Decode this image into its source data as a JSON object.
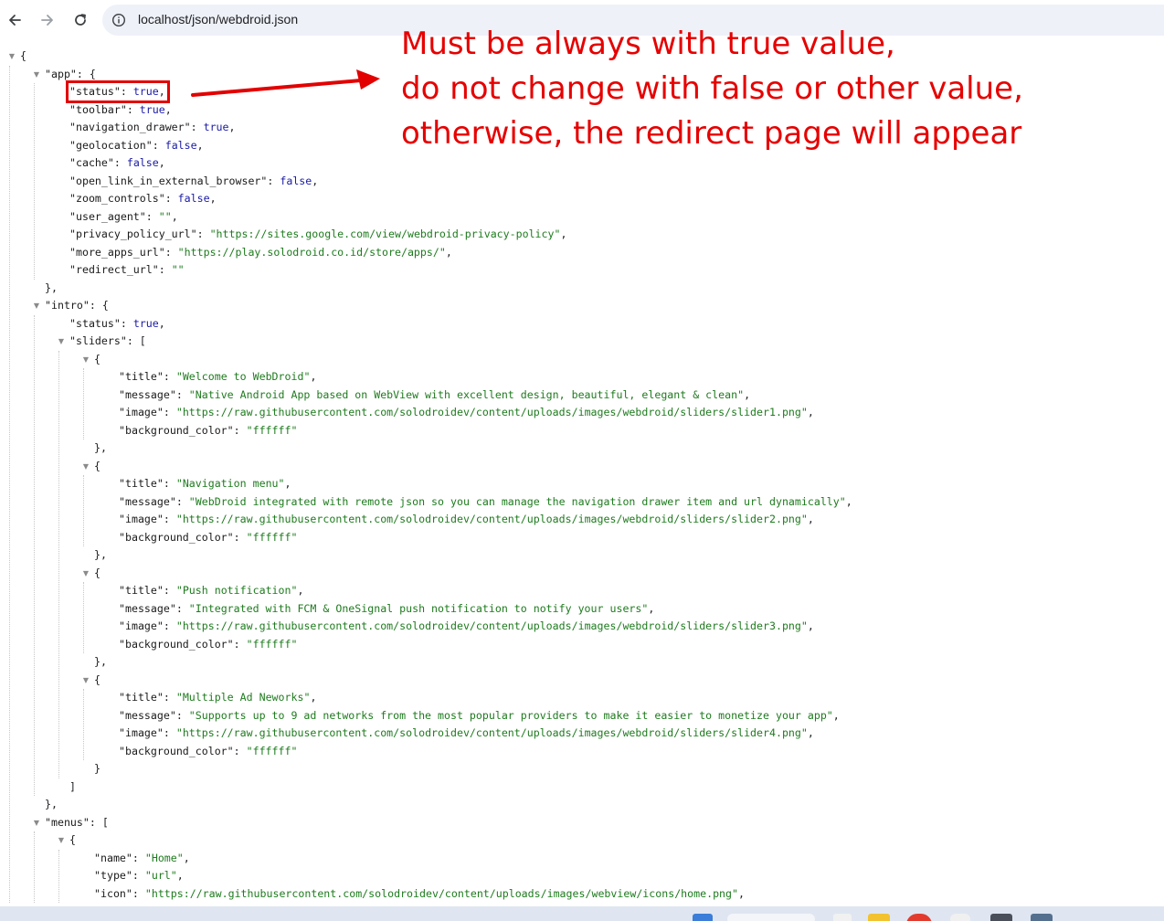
{
  "browser": {
    "url": "localhost/json/webdroid.json",
    "back_label": "Back",
    "forward_label": "Forward",
    "reload_label": "Reload"
  },
  "annotation": {
    "lines": [
      "Must be always with true value,",
      "do not change with false or other value,",
      "otherwise, the redirect page will appear"
    ],
    "color": "#e60000"
  },
  "json_lines": [
    {
      "i": 0,
      "fold": true,
      "t": [
        [
          "p",
          "{"
        ]
      ]
    },
    {
      "i": 1,
      "fold": true,
      "t": [
        [
          "k",
          "\"app\""
        ],
        [
          "p",
          ": {"
        ]
      ]
    },
    {
      "i": 2,
      "t": [
        [
          "k",
          "\"status\""
        ],
        [
          "p",
          ": "
        ],
        [
          "b",
          "true"
        ],
        [
          "p",
          ","
        ]
      ]
    },
    {
      "i": 2,
      "t": [
        [
          "k",
          "\"toolbar\""
        ],
        [
          "p",
          ": "
        ],
        [
          "b",
          "true"
        ],
        [
          "p",
          ","
        ]
      ]
    },
    {
      "i": 2,
      "t": [
        [
          "k",
          "\"navigation_drawer\""
        ],
        [
          "p",
          ": "
        ],
        [
          "b",
          "true"
        ],
        [
          "p",
          ","
        ]
      ]
    },
    {
      "i": 2,
      "t": [
        [
          "k",
          "\"geolocation\""
        ],
        [
          "p",
          ": "
        ],
        [
          "b",
          "false"
        ],
        [
          "p",
          ","
        ]
      ]
    },
    {
      "i": 2,
      "t": [
        [
          "k",
          "\"cache\""
        ],
        [
          "p",
          ": "
        ],
        [
          "b",
          "false"
        ],
        [
          "p",
          ","
        ]
      ]
    },
    {
      "i": 2,
      "t": [
        [
          "k",
          "\"open_link_in_external_browser\""
        ],
        [
          "p",
          ": "
        ],
        [
          "b",
          "false"
        ],
        [
          "p",
          ","
        ]
      ]
    },
    {
      "i": 2,
      "t": [
        [
          "k",
          "\"zoom_controls\""
        ],
        [
          "p",
          ": "
        ],
        [
          "b",
          "false"
        ],
        [
          "p",
          ","
        ]
      ]
    },
    {
      "i": 2,
      "t": [
        [
          "k",
          "\"user_agent\""
        ],
        [
          "p",
          ": "
        ],
        [
          "s",
          "\"\""
        ],
        [
          "p",
          ","
        ]
      ]
    },
    {
      "i": 2,
      "t": [
        [
          "k",
          "\"privacy_policy_url\""
        ],
        [
          "p",
          ": "
        ],
        [
          "s",
          "\"https://sites.google.com/view/webdroid-privacy-policy\""
        ],
        [
          "p",
          ","
        ]
      ]
    },
    {
      "i": 2,
      "t": [
        [
          "k",
          "\"more_apps_url\""
        ],
        [
          "p",
          ": "
        ],
        [
          "s",
          "\"https://play.solodroid.co.id/store/apps/\""
        ],
        [
          "p",
          ","
        ]
      ]
    },
    {
      "i": 2,
      "t": [
        [
          "k",
          "\"redirect_url\""
        ],
        [
          "p",
          ": "
        ],
        [
          "s",
          "\"\""
        ]
      ]
    },
    {
      "i": 1,
      "t": [
        [
          "p",
          "},"
        ]
      ]
    },
    {
      "i": 1,
      "fold": true,
      "t": [
        [
          "k",
          "\"intro\""
        ],
        [
          "p",
          ": {"
        ]
      ]
    },
    {
      "i": 2,
      "t": [
        [
          "k",
          "\"status\""
        ],
        [
          "p",
          ": "
        ],
        [
          "b",
          "true"
        ],
        [
          "p",
          ","
        ]
      ]
    },
    {
      "i": 2,
      "fold": true,
      "t": [
        [
          "k",
          "\"sliders\""
        ],
        [
          "p",
          ": ["
        ]
      ]
    },
    {
      "i": 3,
      "fold": true,
      "t": [
        [
          "p",
          "{"
        ]
      ]
    },
    {
      "i": 4,
      "t": [
        [
          "k",
          "\"title\""
        ],
        [
          "p",
          ": "
        ],
        [
          "s",
          "\"Welcome to WebDroid\""
        ],
        [
          "p",
          ","
        ]
      ]
    },
    {
      "i": 4,
      "t": [
        [
          "k",
          "\"message\""
        ],
        [
          "p",
          ": "
        ],
        [
          "s",
          "\"Native Android App based on WebView with excellent design, beautiful, elegant & clean\""
        ],
        [
          "p",
          ","
        ]
      ]
    },
    {
      "i": 4,
      "t": [
        [
          "k",
          "\"image\""
        ],
        [
          "p",
          ": "
        ],
        [
          "s",
          "\"https://raw.githubusercontent.com/solodroidev/content/uploads/images/webdroid/sliders/slider1.png\""
        ],
        [
          "p",
          ","
        ]
      ]
    },
    {
      "i": 4,
      "t": [
        [
          "k",
          "\"background_color\""
        ],
        [
          "p",
          ": "
        ],
        [
          "s",
          "\"ffffff\""
        ]
      ]
    },
    {
      "i": 3,
      "t": [
        [
          "p",
          "},"
        ]
      ]
    },
    {
      "i": 3,
      "fold": true,
      "t": [
        [
          "p",
          "{"
        ]
      ]
    },
    {
      "i": 4,
      "t": [
        [
          "k",
          "\"title\""
        ],
        [
          "p",
          ": "
        ],
        [
          "s",
          "\"Navigation menu\""
        ],
        [
          "p",
          ","
        ]
      ]
    },
    {
      "i": 4,
      "t": [
        [
          "k",
          "\"message\""
        ],
        [
          "p",
          ": "
        ],
        [
          "s",
          "\"WebDroid integrated with remote json so you can manage the navigation drawer item and url dynamically\""
        ],
        [
          "p",
          ","
        ]
      ]
    },
    {
      "i": 4,
      "t": [
        [
          "k",
          "\"image\""
        ],
        [
          "p",
          ": "
        ],
        [
          "s",
          "\"https://raw.githubusercontent.com/solodroidev/content/uploads/images/webdroid/sliders/slider2.png\""
        ],
        [
          "p",
          ","
        ]
      ]
    },
    {
      "i": 4,
      "t": [
        [
          "k",
          "\"background_color\""
        ],
        [
          "p",
          ": "
        ],
        [
          "s",
          "\"ffffff\""
        ]
      ]
    },
    {
      "i": 3,
      "t": [
        [
          "p",
          "},"
        ]
      ]
    },
    {
      "i": 3,
      "fold": true,
      "t": [
        [
          "p",
          "{"
        ]
      ]
    },
    {
      "i": 4,
      "t": [
        [
          "k",
          "\"title\""
        ],
        [
          "p",
          ": "
        ],
        [
          "s",
          "\"Push notification\""
        ],
        [
          "p",
          ","
        ]
      ]
    },
    {
      "i": 4,
      "t": [
        [
          "k",
          "\"message\""
        ],
        [
          "p",
          ": "
        ],
        [
          "s",
          "\"Integrated with FCM & OneSignal push notification to notify your users\""
        ],
        [
          "p",
          ","
        ]
      ]
    },
    {
      "i": 4,
      "t": [
        [
          "k",
          "\"image\""
        ],
        [
          "p",
          ": "
        ],
        [
          "s",
          "\"https://raw.githubusercontent.com/solodroidev/content/uploads/images/webdroid/sliders/slider3.png\""
        ],
        [
          "p",
          ","
        ]
      ]
    },
    {
      "i": 4,
      "t": [
        [
          "k",
          "\"background_color\""
        ],
        [
          "p",
          ": "
        ],
        [
          "s",
          "\"ffffff\""
        ]
      ]
    },
    {
      "i": 3,
      "t": [
        [
          "p",
          "},"
        ]
      ]
    },
    {
      "i": 3,
      "fold": true,
      "t": [
        [
          "p",
          "{"
        ]
      ]
    },
    {
      "i": 4,
      "t": [
        [
          "k",
          "\"title\""
        ],
        [
          "p",
          ": "
        ],
        [
          "s",
          "\"Multiple Ad Neworks\""
        ],
        [
          "p",
          ","
        ]
      ]
    },
    {
      "i": 4,
      "t": [
        [
          "k",
          "\"message\""
        ],
        [
          "p",
          ": "
        ],
        [
          "s",
          "\"Supports up to 9 ad networks from the most popular providers to make it easier to monetize your app\""
        ],
        [
          "p",
          ","
        ]
      ]
    },
    {
      "i": 4,
      "t": [
        [
          "k",
          "\"image\""
        ],
        [
          "p",
          ": "
        ],
        [
          "s",
          "\"https://raw.githubusercontent.com/solodroidev/content/uploads/images/webdroid/sliders/slider4.png\""
        ],
        [
          "p",
          ","
        ]
      ]
    },
    {
      "i": 4,
      "t": [
        [
          "k",
          "\"background_color\""
        ],
        [
          "p",
          ": "
        ],
        [
          "s",
          "\"ffffff\""
        ]
      ]
    },
    {
      "i": 3,
      "t": [
        [
          "p",
          "}"
        ]
      ]
    },
    {
      "i": 2,
      "t": [
        [
          "p",
          "]"
        ]
      ]
    },
    {
      "i": 1,
      "t": [
        [
          "p",
          "},"
        ]
      ]
    },
    {
      "i": 1,
      "fold": true,
      "t": [
        [
          "k",
          "\"menus\""
        ],
        [
          "p",
          ": ["
        ]
      ]
    },
    {
      "i": 2,
      "fold": true,
      "t": [
        [
          "p",
          "{"
        ]
      ]
    },
    {
      "i": 3,
      "t": [
        [
          "k",
          "\"name\""
        ],
        [
          "p",
          ": "
        ],
        [
          "s",
          "\"Home\""
        ],
        [
          "p",
          ","
        ]
      ]
    },
    {
      "i": 3,
      "t": [
        [
          "k",
          "\"type\""
        ],
        [
          "p",
          ": "
        ],
        [
          "s",
          "\"url\""
        ],
        [
          "p",
          ","
        ]
      ]
    },
    {
      "i": 3,
      "t": [
        [
          "k",
          "\"icon\""
        ],
        [
          "p",
          ": "
        ],
        [
          "s",
          "\"https://raw.githubusercontent.com/solodroidev/content/uploads/images/webview/icons/home.png\""
        ],
        [
          "p",
          ","
        ]
      ]
    }
  ]
}
